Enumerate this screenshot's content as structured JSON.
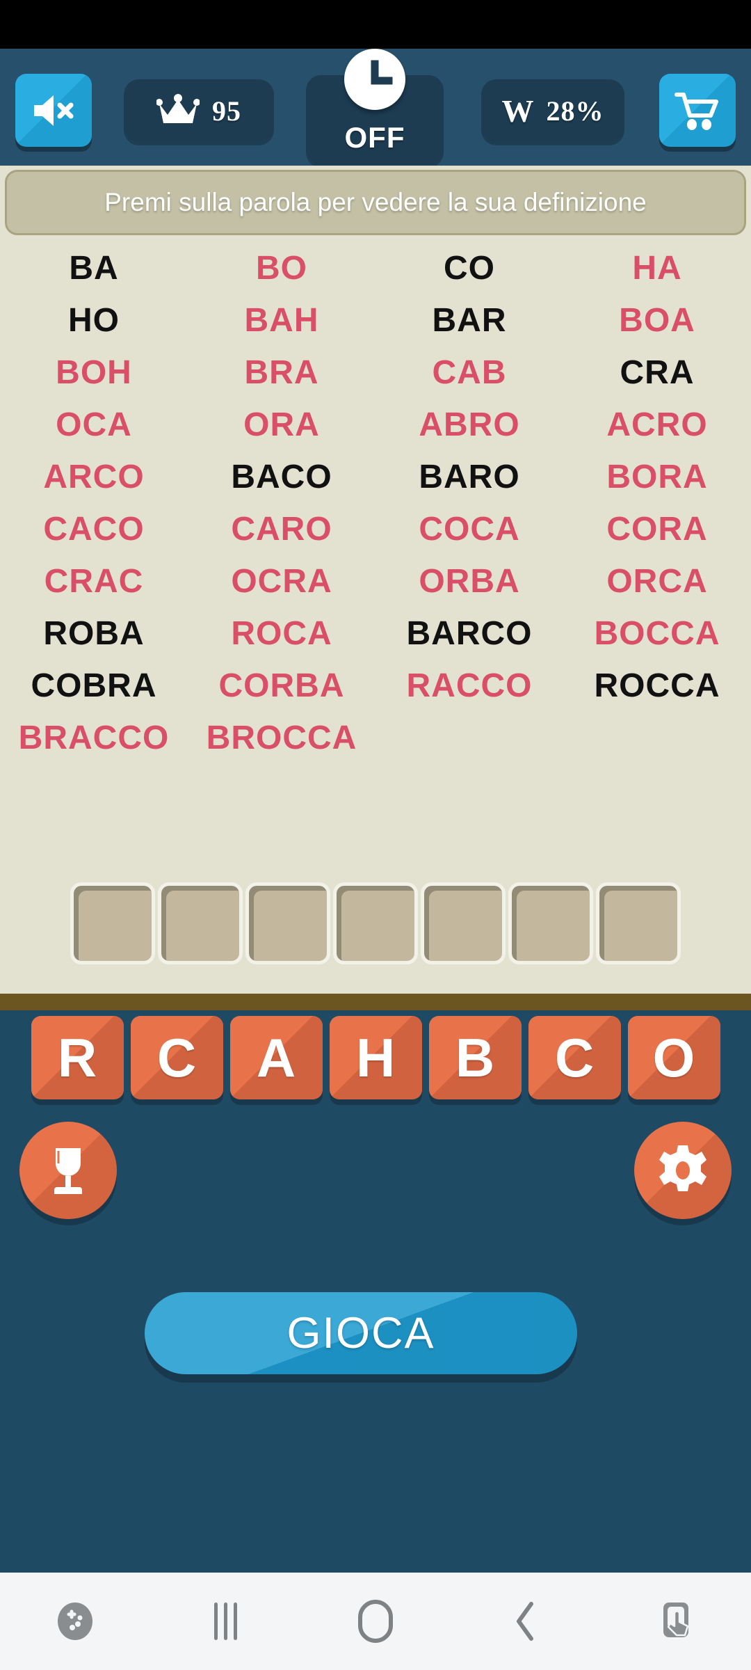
{
  "app": {
    "background_color": "#1f4a63",
    "panel_color": "#e3e2d1",
    "accent_orange": "#e8734a",
    "accent_blue": "#1e9bd0",
    "word_found_color": "#111111",
    "word_missing_color": "#d94f67"
  },
  "top_bar": {
    "mute_icon": "speaker-mute-icon",
    "coins": {
      "icon": "crown-icon",
      "value": "95"
    },
    "timer": {
      "icon": "clock-icon",
      "label": "OFF"
    },
    "wins": {
      "letter": "W",
      "value": "28%"
    },
    "shop_icon": "shopping-cart-icon"
  },
  "hint": {
    "text": "Premi sulla parola per vedere la sua definizione"
  },
  "word_grid": {
    "columns": 4,
    "rows": [
      [
        {
          "word": "BA",
          "found": true
        },
        {
          "word": "BO",
          "found": false
        },
        {
          "word": "CO",
          "found": true
        },
        {
          "word": "HA",
          "found": false
        }
      ],
      [
        {
          "word": "HO",
          "found": true
        },
        {
          "word": "BAH",
          "found": false
        },
        {
          "word": "BAR",
          "found": true
        },
        {
          "word": "BOA",
          "found": false
        }
      ],
      [
        {
          "word": "BOH",
          "found": false
        },
        {
          "word": "BRA",
          "found": false
        },
        {
          "word": "CAB",
          "found": false
        },
        {
          "word": "CRA",
          "found": true
        }
      ],
      [
        {
          "word": "OCA",
          "found": false
        },
        {
          "word": "ORA",
          "found": false
        },
        {
          "word": "ABRO",
          "found": false
        },
        {
          "word": "ACRO",
          "found": false
        }
      ],
      [
        {
          "word": "ARCO",
          "found": false
        },
        {
          "word": "BACO",
          "found": true
        },
        {
          "word": "BARO",
          "found": true
        },
        {
          "word": "BORA",
          "found": false
        }
      ],
      [
        {
          "word": "CACO",
          "found": false
        },
        {
          "word": "CARO",
          "found": false
        },
        {
          "word": "COCA",
          "found": false
        },
        {
          "word": "CORA",
          "found": false
        }
      ],
      [
        {
          "word": "CRAC",
          "found": false
        },
        {
          "word": "OCRA",
          "found": false
        },
        {
          "word": "ORBA",
          "found": false
        },
        {
          "word": "ORCA",
          "found": false
        }
      ],
      [
        {
          "word": "ROBA",
          "found": true
        },
        {
          "word": "ROCA",
          "found": false
        },
        {
          "word": "BARCO",
          "found": true
        },
        {
          "word": "BOCCA",
          "found": false
        }
      ],
      [
        {
          "word": "COBRA",
          "found": true
        },
        {
          "word": "CORBA",
          "found": false
        },
        {
          "word": "RACCO",
          "found": false
        },
        {
          "word": "ROCCA",
          "found": true
        }
      ],
      [
        {
          "word": "BRACCO",
          "found": false
        },
        {
          "word": "BROCCA",
          "found": false
        },
        {
          "word": "",
          "found": true
        },
        {
          "word": "",
          "found": true
        }
      ]
    ]
  },
  "answer_slots": {
    "count": 7,
    "values": [
      "",
      "",
      "",
      "",
      "",
      "",
      ""
    ]
  },
  "letter_tiles": [
    "R",
    "C",
    "A",
    "H",
    "B",
    "C",
    "O"
  ],
  "buttons": {
    "trophy_icon": "trophy-icon",
    "settings_icon": "gear-icon",
    "play_label": "GIOCA"
  },
  "nav_bar": {
    "items": [
      {
        "name": "game-tools-icon",
        "label": ""
      },
      {
        "name": "recents-icon",
        "label": ""
      },
      {
        "name": "home-icon",
        "label": ""
      },
      {
        "name": "back-icon",
        "label": ""
      },
      {
        "name": "touch-assist-icon",
        "label": ""
      }
    ]
  }
}
